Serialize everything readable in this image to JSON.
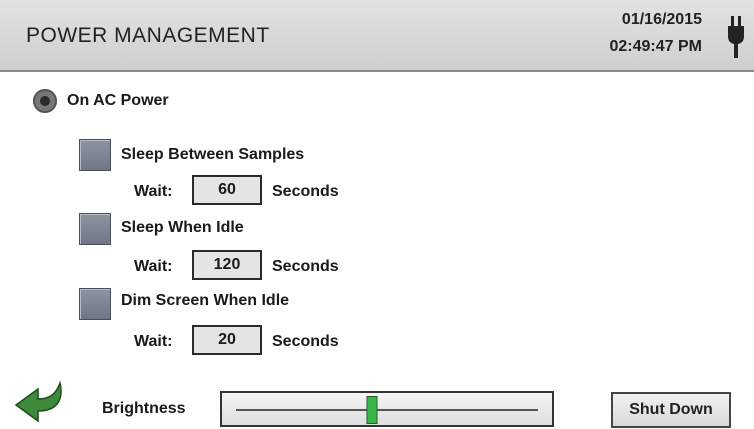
{
  "header": {
    "title": "POWER MANAGEMENT",
    "date": "01/16/2015",
    "time": "02:49:47 PM",
    "power_icon": "plug-icon"
  },
  "power_source": {
    "label": "On AC Power",
    "selected": true
  },
  "options": [
    {
      "label": "Sleep Between Samples",
      "checked": false,
      "wait_label": "Wait:",
      "wait_value": "60",
      "unit": "Seconds"
    },
    {
      "label": "Sleep When Idle",
      "checked": false,
      "wait_label": "Wait:",
      "wait_value": "120",
      "unit": "Seconds"
    },
    {
      "label": "Dim Screen When Idle",
      "checked": false,
      "wait_label": "Wait:",
      "wait_value": "20",
      "unit": "Seconds"
    }
  ],
  "footer": {
    "back_icon": "back-arrow-icon",
    "brightness_label": "Brightness",
    "brightness_level": 0.45,
    "shutdown_label": "Shut Down"
  },
  "colors": {
    "header_bg": "#d6d6d6",
    "checkbox": "#7d8494",
    "slider_thumb": "#39b54a",
    "back_arrow": "#3f8a3a"
  }
}
